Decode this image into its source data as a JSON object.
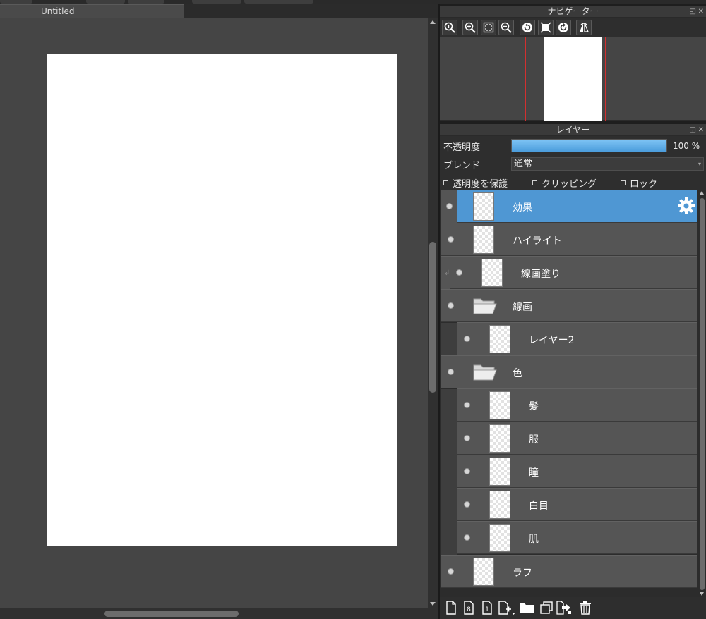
{
  "document": {
    "tab_title": "Untitled"
  },
  "navigator": {
    "title": "ナビゲーター",
    "buttons": [
      {
        "icon": "zoom-actual-icon"
      },
      {
        "icon": "zoom-in-icon"
      },
      {
        "icon": "fit-window-icon"
      },
      {
        "icon": "zoom-out-icon"
      },
      {
        "icon": "rotate-left-icon"
      },
      {
        "icon": "reset-view-icon"
      },
      {
        "icon": "rotate-right-icon"
      },
      {
        "icon": "flip-horizontal-icon"
      }
    ]
  },
  "layers_panel": {
    "title": "レイヤー",
    "opacity_label": "不透明度",
    "opacity_value": 100,
    "opacity_text": "100 %",
    "blend_label": "ブレンド",
    "blend_value": "通常",
    "protect_alpha_label": "透明度を保護",
    "clipping_label": "クリッピング",
    "lock_label": "ロック",
    "layers": [
      {
        "name": "効果",
        "type": "layer",
        "selected": true,
        "indent": 0
      },
      {
        "name": "ハイライト",
        "type": "layer",
        "indent": 0
      },
      {
        "name": "線画塗り",
        "type": "layer",
        "indent": 0,
        "clipped": true
      },
      {
        "name": "線画",
        "type": "folder",
        "indent": 0
      },
      {
        "name": "レイヤー2",
        "type": "layer",
        "indent": 1
      },
      {
        "name": "色",
        "type": "folder",
        "indent": 0
      },
      {
        "name": "髪",
        "type": "layer",
        "indent": 1
      },
      {
        "name": "服",
        "type": "layer",
        "indent": 1
      },
      {
        "name": "瞳",
        "type": "layer",
        "indent": 1
      },
      {
        "name": "白目",
        "type": "layer",
        "indent": 1
      },
      {
        "name": "肌",
        "type": "layer",
        "indent": 1
      },
      {
        "name": "ラフ",
        "type": "layer",
        "indent": 0
      }
    ],
    "toolbar_icons": [
      "new-layer-icon",
      "new-8bit-layer-icon",
      "new-1bit-layer-icon",
      "add-layer-menu-icon",
      "new-folder-icon",
      "duplicate-layer-icon",
      "merge-down-icon",
      "delete-layer-icon"
    ]
  },
  "colors": {
    "selected_layer": "#4f97d3",
    "opacity_fill": "#5aaae6",
    "canvas_bg": "#454545"
  }
}
